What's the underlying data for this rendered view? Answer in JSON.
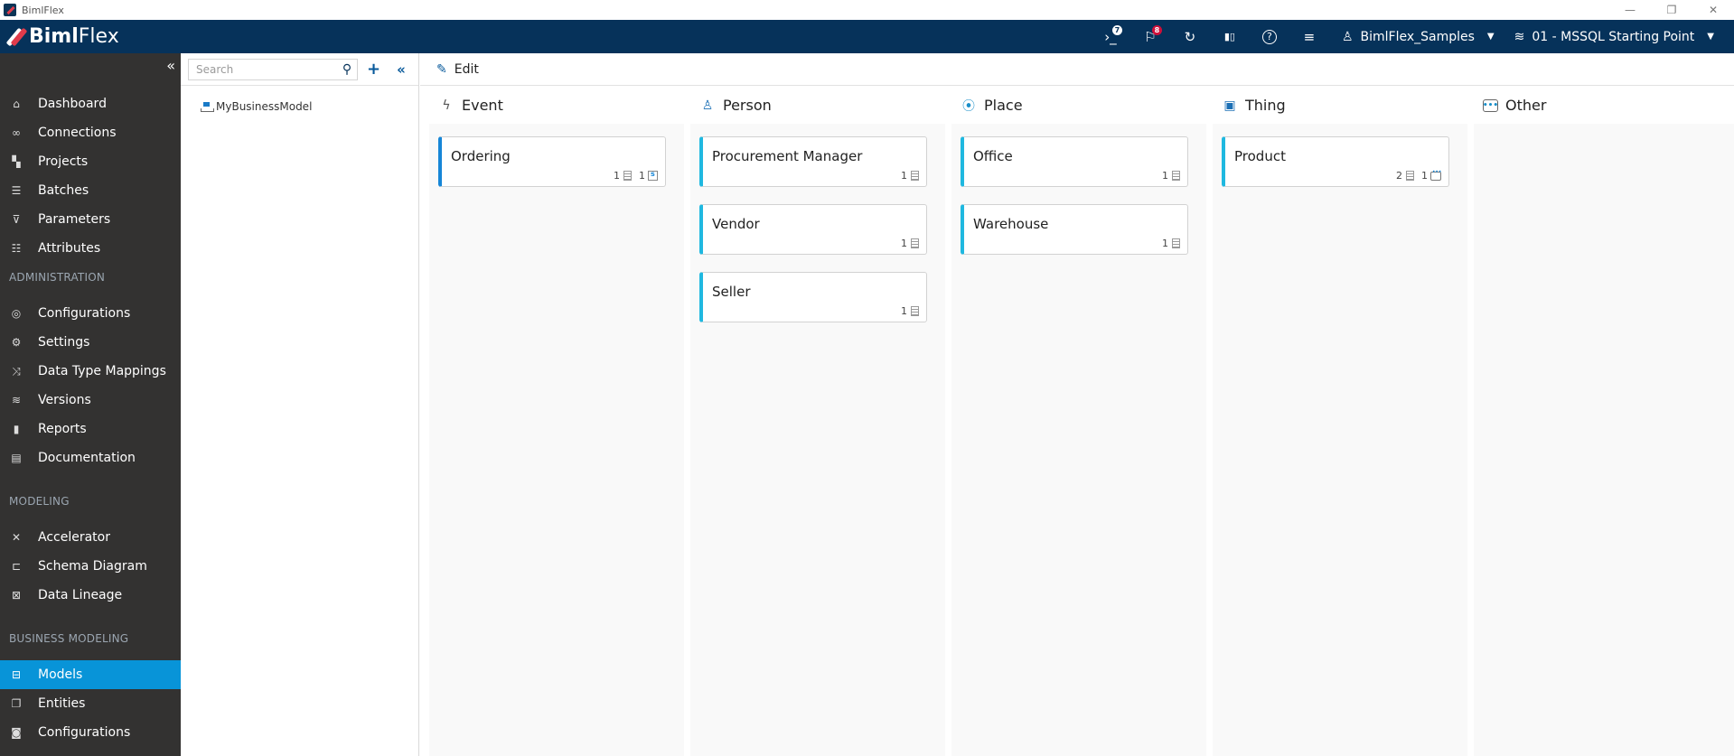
{
  "window": {
    "title": "BimlFlex",
    "controls": {
      "minimize": "—",
      "restore": "❐",
      "close": "✕"
    }
  },
  "header": {
    "logo_bold": "Biml",
    "logo_light": "Flex",
    "icons": [
      {
        "name": "console-icon",
        "glyph": "›_",
        "badge": "7",
        "badge_color": "#ffffff"
      },
      {
        "name": "flag-icon",
        "glyph": "⚐",
        "badge": "8",
        "badge_color": "#d0103a"
      },
      {
        "name": "refresh-icon",
        "glyph": "↻"
      },
      {
        "name": "chart-icon",
        "glyph": "▮▯"
      },
      {
        "name": "help-icon",
        "glyph": "?"
      },
      {
        "name": "server-icon",
        "glyph": "≡"
      }
    ],
    "customer": "BimlFlex_Samples",
    "version": "01 - MSSQL Starting Point",
    "background": "#06325a"
  },
  "sidebar": {
    "collapse": "«",
    "items": [
      {
        "label": "Dashboard",
        "icon": "home-icon",
        "glyph": "⌂"
      },
      {
        "label": "Connections",
        "icon": "link-icon",
        "glyph": "∞"
      },
      {
        "label": "Projects",
        "icon": "projects-icon",
        "glyph": "▚"
      },
      {
        "label": "Batches",
        "icon": "batches-icon",
        "glyph": "☰"
      },
      {
        "label": "Parameters",
        "icon": "parameters-icon",
        "glyph": "⊽"
      },
      {
        "label": "Attributes",
        "icon": "attributes-icon",
        "glyph": "☷"
      }
    ],
    "admin_section": "ADMINISTRATION",
    "admin_items": [
      {
        "label": "Configurations",
        "icon": "configurations-icon",
        "glyph": "◎"
      },
      {
        "label": "Settings",
        "icon": "settings-icon",
        "glyph": "⚙"
      },
      {
        "label": "Data Type Mappings",
        "icon": "shuffle-icon",
        "glyph": "⤨"
      },
      {
        "label": "Versions",
        "icon": "layers-icon",
        "glyph": "≋"
      },
      {
        "label": "Reports",
        "icon": "reports-icon",
        "glyph": "▮"
      },
      {
        "label": "Documentation",
        "icon": "documentation-icon",
        "glyph": "▤"
      }
    ],
    "modeling_section": "MODELING",
    "modeling_items": [
      {
        "label": "Accelerator",
        "icon": "accelerator-icon",
        "glyph": "✕"
      },
      {
        "label": "Schema Diagram",
        "icon": "schema-diagram-icon",
        "glyph": "⊏"
      },
      {
        "label": "Data Lineage",
        "icon": "data-lineage-icon",
        "glyph": "⊠"
      }
    ],
    "business_section": "BUSINESS MODELING",
    "business_items": [
      {
        "label": "Models",
        "icon": "models-icon",
        "glyph": "⊟",
        "active": true
      },
      {
        "label": "Entities",
        "icon": "entities-icon",
        "glyph": "❐"
      },
      {
        "label": "Configurations",
        "icon": "configurations-icon",
        "glyph": "◙"
      }
    ],
    "active_color": "#0894d8"
  },
  "tree": {
    "search_placeholder": "Search",
    "search_value": "",
    "add": "+",
    "collapse": "«",
    "items": [
      {
        "label": "MyBusinessModel"
      }
    ]
  },
  "toolbar": {
    "edit_label": "Edit"
  },
  "board": {
    "columns": [
      {
        "title": "Event",
        "icon": "lightning-icon",
        "glyph": "ϟ",
        "cards": [
          {
            "title": "Ordering",
            "tables": "1",
            "extra_count": "1",
            "extra_icon": "calendar"
          }
        ]
      },
      {
        "title": "Person",
        "icon": "person-icon",
        "glyph": "♙",
        "cards": [
          {
            "title": "Procurement Manager",
            "tables": "1"
          },
          {
            "title": "Vendor",
            "tables": "1"
          },
          {
            "title": "Seller",
            "tables": "1"
          }
        ]
      },
      {
        "title": "Place",
        "icon": "location-icon",
        "glyph": "⦿",
        "cards": [
          {
            "title": "Office",
            "tables": "1"
          },
          {
            "title": "Warehouse",
            "tables": "1"
          }
        ]
      },
      {
        "title": "Thing",
        "icon": "thing-icon",
        "glyph": "▣",
        "cards": [
          {
            "title": "Product",
            "tables": "2",
            "extra_count": "1",
            "extra_icon": "comment"
          }
        ]
      },
      {
        "title": "Other",
        "icon": "comment-icon",
        "glyph": "💬",
        "cards": []
      }
    ]
  }
}
